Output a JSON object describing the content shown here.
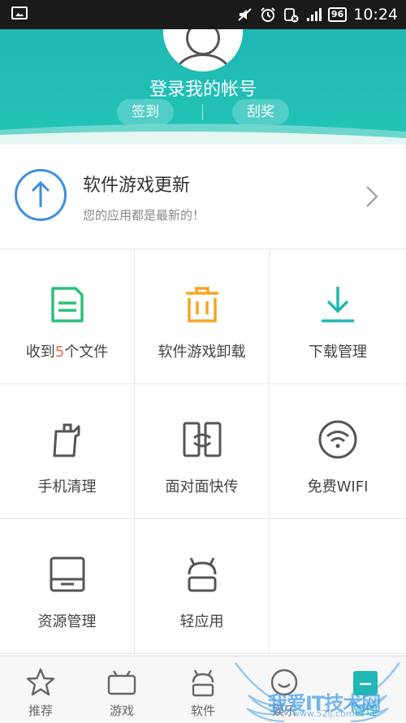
{
  "status": {
    "battery": "96",
    "time": "10:24"
  },
  "header": {
    "login": "登录我的帐号",
    "sign_in": "签到",
    "lottery": "刮奖"
  },
  "update": {
    "title": "软件游戏更新",
    "subtitle": "您的应用都是最新的！"
  },
  "grid": [
    {
      "label_pre": "收到",
      "label_num": "5",
      "label_post": "个文件",
      "icon": "document-icon",
      "color": "#2cc07a"
    },
    {
      "label": "软件游戏卸载",
      "icon": "trash-icon",
      "color": "#f5a623"
    },
    {
      "label": "下载管理",
      "icon": "download-icon",
      "color": "#1fb8b3"
    },
    {
      "label": "手机清理",
      "icon": "clean-icon",
      "color": "#555555"
    },
    {
      "label": "面对面快传",
      "icon": "transfer-icon",
      "color": "#555555"
    },
    {
      "label": "免费WIFI",
      "icon": "wifi-icon",
      "color": "#555555"
    },
    {
      "label": "资源管理",
      "icon": "folder-icon",
      "color": "#555555"
    },
    {
      "label": "轻应用",
      "icon": "android-icon",
      "color": "#555555"
    }
  ],
  "tabs": [
    {
      "label": "推荐",
      "icon": "star-icon"
    },
    {
      "label": "游戏",
      "icon": "gamepad-icon"
    },
    {
      "label": "软件",
      "icon": "android-icon"
    },
    {
      "label": "娱乐",
      "icon": "smile-icon"
    },
    {
      "label": "管理",
      "icon": "manage-icon",
      "active": true
    }
  ],
  "watermark": {
    "text": "我爱IT技术网",
    "url": "www.52ij.com"
  },
  "colors": {
    "accent": "#1fb8b3",
    "highlight": "#f06a4a",
    "update_blue": "#3e8fe0"
  }
}
